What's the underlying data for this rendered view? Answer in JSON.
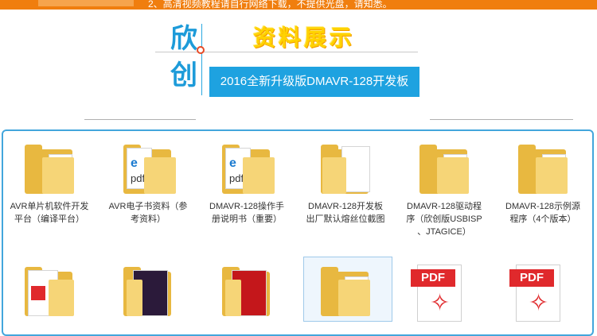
{
  "header": {
    "banner_text": "2、高清视频教程请自行网络下载，不提供光盘，请知悉。",
    "brand_char_1": "欣",
    "brand_char_2": "创",
    "section_title": "资料展示",
    "product_badge": "2016全新升级版DMAVR-128开发板"
  },
  "colors": {
    "accent": "#1ea2e0",
    "orange": "#f07e0e",
    "title_yellow": "#ffd200",
    "panel_border": "#43a6dc",
    "pdf_red": "#e0292c"
  },
  "files": [
    {
      "label_1": "AVR单片机软件开发",
      "label_2": "平台（编译平台）",
      "icon": "folder-icon"
    },
    {
      "label_1": "AVR电子书资料（参",
      "label_2": "考资料）",
      "icon": "folder-pdf-icon"
    },
    {
      "label_1": "DMAVR-128操作手",
      "label_2": "册说明书（重要）",
      "icon": "folder-pdf-icon"
    },
    {
      "label_1": "DMAVR-128开发板",
      "label_2": "出厂默认熔丝位截图",
      "icon": "folder-doc-icon"
    },
    {
      "label_1": "DMAVR-128驱动程",
      "label_2": "序（欣创版USBISP",
      "label_3": "、JTAGICE）",
      "icon": "folder-icon"
    },
    {
      "label_1": "DMAVR-128示例源",
      "label_2": "程序（4个版本）",
      "icon": "folder-icon"
    }
  ],
  "row2": [
    {
      "icon": "folder-pdf-icon"
    },
    {
      "icon": "folder-video-icon"
    },
    {
      "icon": "folder-acrobat-icon"
    },
    {
      "icon": "folder-icon"
    },
    {
      "icon": "pdf-file-icon",
      "badge": "PDF"
    },
    {
      "icon": "pdf-file-icon",
      "badge": "PDF"
    }
  ]
}
